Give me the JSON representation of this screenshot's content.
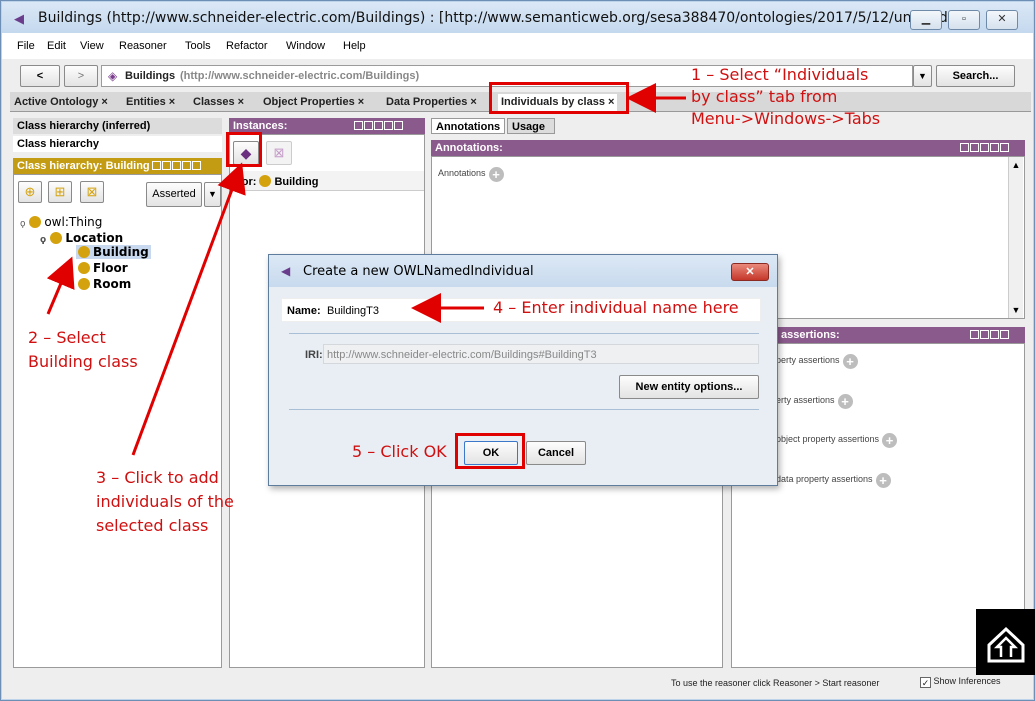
{
  "window": {
    "title": "Buildings (http://www.schneider-electric.com/Buildings)  : [http://www.semanticweb.org/sesa388470/ontologies/2017/5/12/untitled-..."
  },
  "menu": [
    "File",
    "Edit",
    "View",
    "Reasoner",
    "Tools",
    "Refactor",
    "Window",
    "Help"
  ],
  "toolbar": {
    "back": "<",
    "forward": ">",
    "ontology_name": "Buildings",
    "ontology_iri": "(http://www.schneider-electric.com/Buildings)",
    "search": "Search..."
  },
  "tabs": [
    {
      "label": "Active Ontology ×"
    },
    {
      "label": "Entities ×"
    },
    {
      "label": "Classes ×"
    },
    {
      "label": "Object Properties ×"
    },
    {
      "label": "Data Properties ×"
    },
    {
      "label": "Individuals by class ×"
    }
  ],
  "left": {
    "inferred": "Class hierarchy (inferred)",
    "hierarchy": "Class hierarchy",
    "sub_header": "Class hierarchy: Building",
    "asserted": "Asserted",
    "tree": [
      "owl:Thing",
      "Location",
      "Building",
      "Floor",
      "Room"
    ]
  },
  "instances": {
    "header": "Instances:",
    "for_label": "For:",
    "for_class": "Building"
  },
  "right": {
    "tab_annotations": "Annotations",
    "tab_usage": "Usage",
    "annotations_header": "Annotations:",
    "annotations_label": "Annotations",
    "assertions_header": "assertions:",
    "rows": [
      "perty assertions",
      "erty assertions",
      "object property assertions",
      "data property assertions"
    ]
  },
  "dialog": {
    "title": "Create a new OWLNamedIndividual",
    "name_label": "Name:",
    "name_value": "BuildingT3",
    "iri_label": "IRI:",
    "iri_value": "http://www.schneider-electric.com/Buildings#BuildingT3",
    "entity_options": "New entity options...",
    "ok": "OK",
    "cancel": "Cancel"
  },
  "status": {
    "reasoner_text": "To use the reasoner click Reasoner > Start reasoner",
    "show_inferences": "Show Inferences"
  },
  "annotations_overlay": {
    "step1_line1": "1 – Select “Individuals",
    "step1_line2": "by class” tab from",
    "step1_line3": "Menu->Windows->Tabs",
    "step2_line1": "2 – Select",
    "step2_line2": "Building class",
    "step3_line1": "3 – Click to add",
    "step3_line2": "individuals of the",
    "step3_line3": "selected class",
    "step4": "4 – Enter individual name here",
    "step5": "5 – Click OK"
  },
  "colors": {
    "accent_purple": "#8b5a8d",
    "annotation_red": "#e00000",
    "class_dot": "#d4a20c"
  }
}
